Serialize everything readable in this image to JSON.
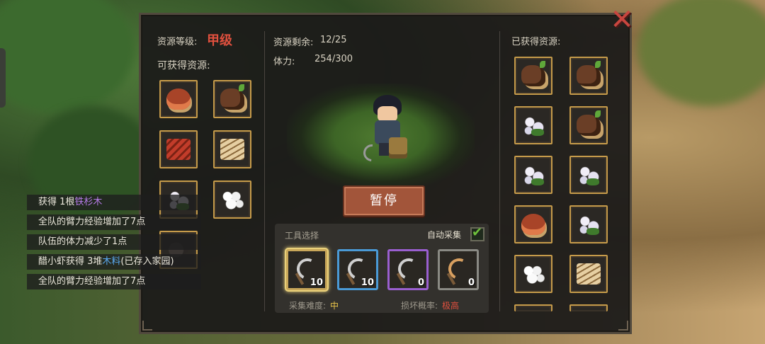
{
  "header": {
    "grade_label": "资源等级:",
    "grade_value": "甲级",
    "available_label": "可获得资源:",
    "remaining_label": "资源剩余:",
    "remaining_value": "12/25",
    "stamina_label": "体力:",
    "stamina_value": "254/300",
    "obtained_label": "已获得资源:"
  },
  "available_resources": [
    "mushroom",
    "wood-log",
    "red-wood",
    "planks",
    "flower",
    "cotton",
    "ore"
  ],
  "obtained_resources": [
    "wood-log",
    "wood-log",
    "flower",
    "wood-log",
    "flower",
    "flower",
    "mushroom",
    "flower",
    "cotton",
    "planks"
  ],
  "pause_button": "暂停",
  "tools": {
    "title": "工具选择",
    "auto_label": "自动采集",
    "auto_checked": true,
    "items": [
      {
        "name": "sickle-1",
        "count": "10",
        "border": "#c9a75a",
        "selected": true
      },
      {
        "name": "sickle-2",
        "count": "10",
        "border": "#4a9ad6",
        "selected": false
      },
      {
        "name": "sickle-3",
        "count": "0",
        "border": "#9a5fd0",
        "selected": false
      },
      {
        "name": "sickle-4",
        "count": "0",
        "border": "#8a8a84",
        "selected": false
      }
    ],
    "difficulty_label": "采集难度:",
    "difficulty_value": "中",
    "breakrate_label": "损坏概率:",
    "breakrate_value": "极高"
  },
  "log": {
    "line1_prefix": "获得 1根",
    "line1_item": "铁杉木",
    "line2": "全队的臂力经验增加了7点",
    "line3": "队伍的体力减少了1点",
    "line4_prefix": "醋小虾获得 3堆",
    "line4_item": "木料",
    "line4_suffix": "(已存入家园)",
    "line5": "全队的臂力经验增加了7点"
  },
  "colors": {
    "grade": "#e0503e",
    "slot_border": "#c69b4a",
    "log_highlight_purple": "#b67be8",
    "log_highlight_blue": "#5aa8f0"
  }
}
